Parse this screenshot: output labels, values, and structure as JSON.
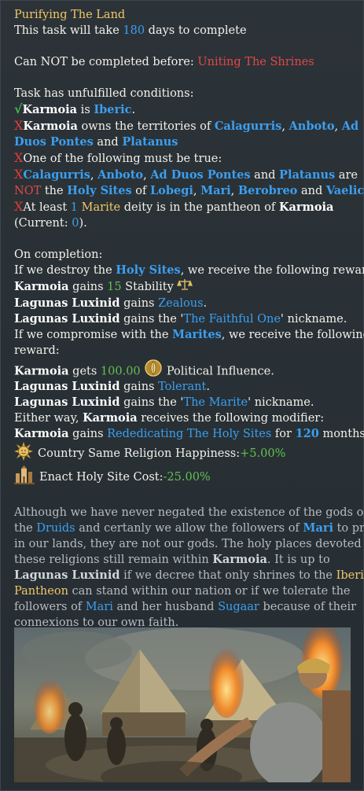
{
  "mission": {
    "title": "Purifying The Land",
    "duration_prefix": "This task will take ",
    "duration_days": "180",
    "duration_suffix": " days to complete",
    "prereq_prefix": "Can NOT be completed before: ",
    "prereq_mission": "Uniting The Shrines"
  },
  "conditions": {
    "header": "Task has unfulfilled conditions:",
    "c1": {
      "check": "√",
      "country": "Karmoia",
      "mid": " is ",
      "culture": "Iberic",
      "end": "."
    },
    "c2": {
      "cross": "X",
      "country": "Karmoia",
      "mid": " owns the territories of ",
      "t1": "Calagurris",
      "comma": ", ",
      "t2": "Anboto",
      "t3": "Ad",
      "t3b": "Duos Pontes",
      "and": " and ",
      "t4": "Platanus"
    },
    "c3": {
      "cross": "X",
      "text": "One of the following must be true:"
    },
    "c4": {
      "cross": "X",
      "t1": "Calagurris",
      "comma": ", ",
      "t2": "Anboto",
      "t3": "Ad Duos Pontes",
      "and": " and ",
      "t4": "Platanus",
      "are": " are",
      "not": "NOT",
      "the": " the ",
      "sites": "Holy Sites",
      "of": " of ",
      "d1": "Lobegi",
      "d2": "Mari",
      "d3": "Berobreo",
      "d4": "Vaelicus"
    },
    "c5": {
      "cross": "X",
      "pre": "At least ",
      "num": "1",
      "space": " ",
      "deity": "Marite",
      "mid": " deity is in the pantheon of ",
      "country": "Karmoia",
      "cur_pre": "(Current: ",
      "cur_val": "0",
      "cur_end": ")."
    }
  },
  "completion": {
    "header": "On completion:",
    "opt1_pre": "If we destroy the ",
    "opt1_sites": "Holy Sites",
    "opt1_post": ", we receive the following reward:",
    "r1_country": "Karmoia",
    "r1_mid": " gains ",
    "r1_val": "15",
    "r1_stat": " Stability",
    "r2_ruler": "Lagunas Luxinid",
    "r2_mid": " gains ",
    "r2_trait": "Zealous",
    "r3_ruler": "Lagunas Luxinid",
    "r3_mid": " gains the '",
    "r3_nick": "The Faithful One",
    "r3_end": "' nickname.",
    "opt2_pre": "If we compromise with the ",
    "opt2_group": "Marites",
    "opt2_post": ", we receive the following",
    "opt2_post2": "reward:",
    "r4_country": "Karmoia",
    "r4_mid": " gets ",
    "r4_val": "100.00",
    "r4_stat": " Political Influence.",
    "r5_ruler": "Lagunas Luxinid",
    "r5_mid": " gains ",
    "r5_trait": "Tolerant",
    "r6_ruler": "Lagunas Luxinid",
    "r6_mid": " gains the '",
    "r6_nick": "The Marite",
    "r6_end": "' nickname.",
    "either_pre": "Either way, ",
    "either_country": "Karmoia",
    "either_post": " receives the following modifier:",
    "mod_country": "Karmoia",
    "mod_mid": " gains ",
    "mod_name": "Rededicating The Holy Sites",
    "mod_for": " for ",
    "mod_months": "120",
    "mod_months_suffix": " months:",
    "m1_label": "Country Same Religion Happiness: ",
    "m1_val": "+5.00%",
    "m2_label": "Enact Holy Site Cost: ",
    "m2_val": "-25.00%"
  },
  "flavor": {
    "l1": "Although we have never negated the existence of the gods of",
    "l2_pre": "the ",
    "l2_druids": "Druids",
    "l2_mid": " and certanly we allow the followers of ",
    "l2_mari": "Mari",
    "l2_post": " to pray",
    "l3": "in our lands, they are not our gods. The holy places devoted to",
    "l4_pre": "these religions still remain within ",
    "l4_country": "Karmoia",
    "l4_post": ". It is up to",
    "l5_ruler": "Lagunas Luxinid",
    "l5_mid": " if we decree that only shrines to the ",
    "l5_iberic": "Iberic",
    "l6_pantheon": "Pantheon",
    "l6_post": " can stand within our nation or if we tolerate the",
    "l7_pre": "followers of ",
    "l7_mari": "Mari",
    "l7_mid": " and her husband ",
    "l7_sugaar": "Sugaar",
    "l7_post": " because of their",
    "l8": "connexions to our own faith."
  },
  "icons": {
    "stability": "scales-icon",
    "influence": "political-influence-icon",
    "happiness": "sun-face-icon",
    "holy_site": "holy-site-icon"
  },
  "colors": {
    "background": "#2a3136",
    "title_gold": "#f1c768",
    "link_blue": "#3c9ff0",
    "negative_red": "#e24848",
    "positive_green": "#62c152",
    "flavor_text": "#b6bcc0"
  }
}
